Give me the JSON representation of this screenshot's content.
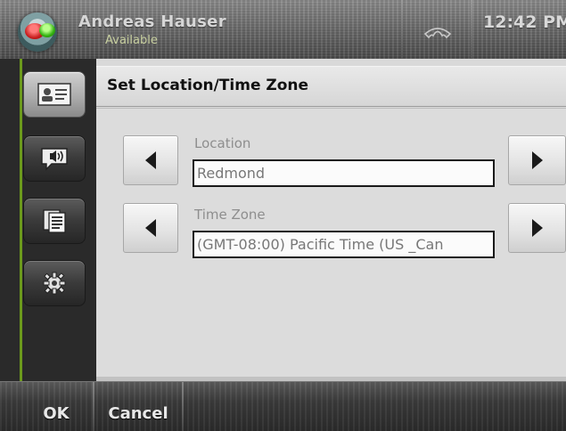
{
  "status_bar": {
    "user_name": "Andreas Hauser",
    "presence_status": "Available",
    "time": "12:42 PM",
    "presence_color": "#c81e1e",
    "phone_icon": "phone-handset-icon"
  },
  "sidebar": {
    "items": [
      {
        "icon": "contact-card-icon",
        "active": true
      },
      {
        "icon": "speech-bubble-icon",
        "active": false
      },
      {
        "icon": "document-list-icon",
        "active": false
      },
      {
        "icon": "gear-icon",
        "active": false
      }
    ]
  },
  "panel": {
    "title": "Set Location/Time Zone",
    "location": {
      "label": "Location",
      "value": "Redmond"
    },
    "time_zone": {
      "label": "Time Zone",
      "value": "(GMT-08:00) Pacific Time (US _Can"
    }
  },
  "softkeys": {
    "ok": "OK",
    "cancel": "Cancel"
  },
  "colors": {
    "accent_green": "#6c9a1c",
    "panel_bg": "#d9d9d9"
  }
}
